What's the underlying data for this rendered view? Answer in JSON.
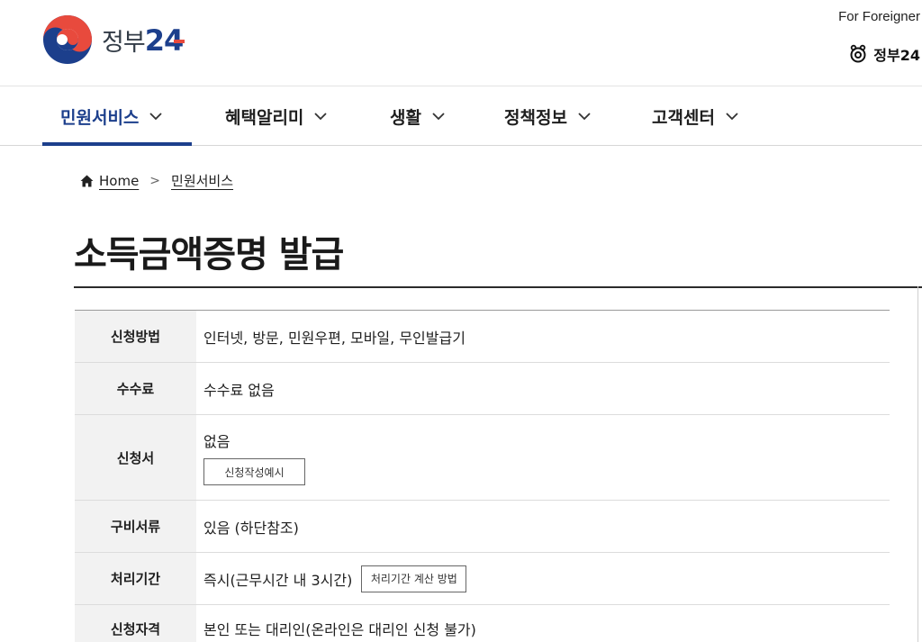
{
  "header": {
    "logo_text_ko": "정부",
    "logo_num_2": "2",
    "logo_num_4": "4",
    "foreigner_link": "For Foreigner",
    "gov_menu_label": "정부24"
  },
  "nav": {
    "items": [
      {
        "label": "민원서비스"
      },
      {
        "label": "혜택알리미"
      },
      {
        "label": "생활"
      },
      {
        "label": "정책정보"
      },
      {
        "label": "고객센터"
      }
    ]
  },
  "breadcrumb": {
    "home": "Home",
    "separator": ">",
    "current": "민원서비스"
  },
  "page": {
    "title": "소득금액증명 발급"
  },
  "info": {
    "rows": [
      {
        "label": "신청방법",
        "value": "인터넷, 방문, 민원우편, 모바일, 무인발급기"
      },
      {
        "label": "수수료",
        "value": "수수료 없음"
      },
      {
        "label": "신청서",
        "value": "없음",
        "button": "신청작성예시"
      },
      {
        "label": "구비서류",
        "value": "있음 (하단참조)"
      },
      {
        "label": "처리기간",
        "value": "즉시(근무시간 내 3시간)",
        "button": "처리기간 계산 방법"
      },
      {
        "label": "신청자격",
        "value": "본인 또는 대리인(온라인은 대리인 신청 불가)"
      }
    ]
  },
  "colors": {
    "brand_blue": "#1c3f8c",
    "brand_red": "#e84a3d",
    "header_bg": "#f2f2f2"
  }
}
